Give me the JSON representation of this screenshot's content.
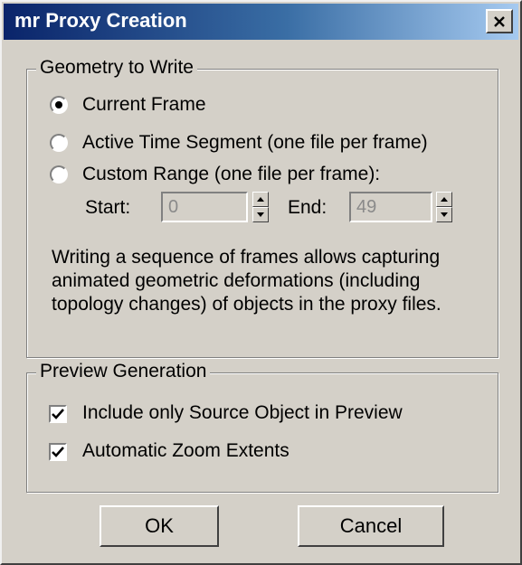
{
  "window": {
    "title": "mr Proxy Creation",
    "close_label": "×"
  },
  "geometry": {
    "legend": "Geometry to Write",
    "options": [
      {
        "label": "Current Frame",
        "selected": true
      },
      {
        "label": "Active Time Segment (one file per frame)",
        "selected": false
      },
      {
        "label": "Custom Range (one file per frame):",
        "selected": false
      }
    ],
    "start_label": "Start:",
    "start_value": "0",
    "end_label": "End:",
    "end_value": "49",
    "description": [
      "Writing a sequence of frames allows capturing",
      "animated geometric deformations (including",
      "topology changes) of objects in the proxy files."
    ]
  },
  "preview": {
    "legend": "Preview Generation",
    "include_source_label": "Include only Source Object in Preview",
    "include_source_checked": true,
    "zoom_extents_label": "Automatic Zoom Extents",
    "zoom_extents_checked": true
  },
  "buttons": {
    "ok": "OK",
    "cancel": "Cancel"
  },
  "colors": {
    "titlebar_start": "#0a246a",
    "titlebar_end": "#a6caf0",
    "face": "#d4d0c8"
  }
}
